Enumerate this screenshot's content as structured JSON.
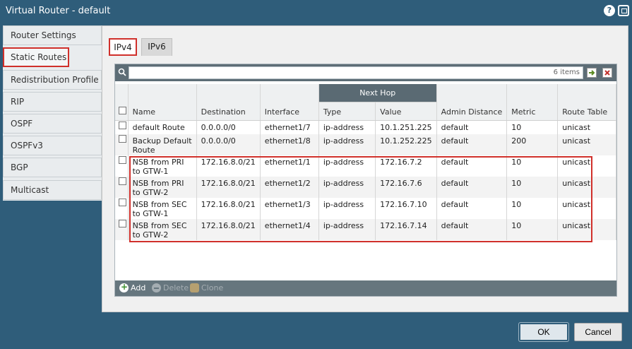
{
  "window": {
    "title": "Virtual Router - default"
  },
  "sidebar": {
    "items": [
      {
        "label": "Router Settings"
      },
      {
        "label": "Static Routes"
      },
      {
        "label": "Redistribution Profile"
      },
      {
        "label": "RIP"
      },
      {
        "label": "OSPF"
      },
      {
        "label": "OSPFv3"
      },
      {
        "label": "BGP"
      },
      {
        "label": "Multicast"
      }
    ]
  },
  "tabs": [
    {
      "label": "IPv4"
    },
    {
      "label": "IPv6"
    }
  ],
  "search": {
    "value": "",
    "count_text": "6 items"
  },
  "table": {
    "group_header": "Next Hop",
    "columns": [
      "Name",
      "Destination",
      "Interface",
      "Type",
      "Value",
      "Admin Distance",
      "Metric",
      "Route Table"
    ],
    "rows": [
      {
        "name1": "default Route",
        "name2": "",
        "destination": "0.0.0.0/0",
        "interface": "ethernet1/7",
        "type": "ip-address",
        "value": "10.1.251.225",
        "admin_distance": "default",
        "metric": "10",
        "route_table": "unicast"
      },
      {
        "name1": "Backup Default",
        "name2": "Route",
        "destination": "0.0.0.0/0",
        "interface": "ethernet1/8",
        "type": "ip-address",
        "value": "10.1.252.225",
        "admin_distance": "default",
        "metric": "200",
        "route_table": "unicast"
      },
      {
        "name1": "NSB from PRI",
        "name2": "to GTW-1",
        "destination": "172.16.8.0/21",
        "interface": "ethernet1/1",
        "type": "ip-address",
        "value": "172.16.7.2",
        "admin_distance": "default",
        "metric": "10",
        "route_table": "unicast"
      },
      {
        "name1": "NSB from PRI",
        "name2": "to GTW-2",
        "destination": "172.16.8.0/21",
        "interface": "ethernet1/2",
        "type": "ip-address",
        "value": "172.16.7.6",
        "admin_distance": "default",
        "metric": "10",
        "route_table": "unicast"
      },
      {
        "name1": "NSB from SEC",
        "name2": "to GTW-1",
        "destination": "172.16.8.0/21",
        "interface": "ethernet1/3",
        "type": "ip-address",
        "value": "172.16.7.10",
        "admin_distance": "default",
        "metric": "10",
        "route_table": "unicast"
      },
      {
        "name1": "NSB from SEC",
        "name2": "to GTW-2",
        "destination": "172.16.8.0/21",
        "interface": "ethernet1/4",
        "type": "ip-address",
        "value": "172.16.7.14",
        "admin_distance": "default",
        "metric": "10",
        "route_table": "unicast"
      }
    ]
  },
  "toolbar": {
    "add": "Add",
    "delete": "Delete",
    "clone": "Clone"
  },
  "footer": {
    "ok": "OK",
    "cancel": "Cancel"
  },
  "colors": {
    "titlebar": "#2f5d7a",
    "highlight": "#d0302b",
    "header_group": "#5a6a73"
  }
}
